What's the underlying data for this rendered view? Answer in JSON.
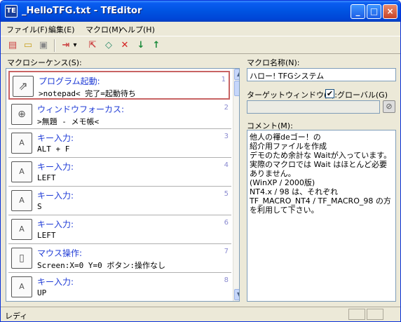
{
  "window": {
    "title": "_HelloTFG.txt - TfEditor",
    "icon_text": "TE"
  },
  "title_buttons": {
    "minimize": "_",
    "maximize": "□",
    "close": "×"
  },
  "menu": [
    "ファイル(F)",
    "編集(E)",
    "マクロ(M)",
    "ヘルプ(H)"
  ],
  "toolbar": {
    "icons": [
      "new-file-icon",
      "open-folder-icon",
      "save-icon",
      "insert-icon",
      "dropdown-arrow-icon",
      "export-icon",
      "eraser-icon",
      "delete-icon",
      "move-down-icon",
      "move-up-icon"
    ],
    "glyphs": {
      "new": "▤",
      "open": "▭",
      "save": "▣",
      "insert": "⇥",
      "dropdown": "▾",
      "export": "⇱",
      "eraser": "◇",
      "delete": "✕",
      "down": "↓",
      "up": "↑"
    },
    "colors": {
      "delete": "#d42020",
      "arrows": "#1a8a3a"
    }
  },
  "sequence": {
    "label": "マクロシーケンス(S):",
    "items": [
      {
        "title": "プログラム起動:",
        "detail": ">notepad< 完了=起動待ち",
        "num": "1",
        "icon": "rocket-icon",
        "glyph": "⇗"
      },
      {
        "title": "ウィンドウフォーカス:",
        "detail": ">無題 - メモ帳<",
        "num": "2",
        "icon": "window-focus-icon",
        "glyph": "⊕"
      },
      {
        "title": "キー入力:",
        "detail": "ALT + F",
        "num": "3",
        "icon": "keyboard-icon",
        "glyph": "A"
      },
      {
        "title": "キー入力:",
        "detail": "LEFT",
        "num": "4",
        "icon": "keyboard-icon",
        "glyph": "A"
      },
      {
        "title": "キー入力:",
        "detail": "S",
        "num": "5",
        "icon": "keyboard-icon",
        "glyph": "A"
      },
      {
        "title": "キー入力:",
        "detail": "LEFT",
        "num": "6",
        "icon": "keyboard-icon",
        "glyph": "A"
      },
      {
        "title": "マウス操作:",
        "detail": "Screen:X=0 Y=0  ボタン:操作なし",
        "num": "7",
        "icon": "mouse-icon",
        "glyph": "▯"
      },
      {
        "title": "キー入力:",
        "detail": "UP",
        "num": "8",
        "icon": "keyboard-icon",
        "glyph": "A"
      }
    ]
  },
  "macro_name": {
    "label": "マクロ名称(N):",
    "value": "ハロー! TFGシステム"
  },
  "target_window": {
    "label": "ターゲットウィンドウ(T):",
    "value": "",
    "global_label": "グローバル(G)",
    "global_checked": true,
    "clear_glyph": "⊘"
  },
  "comment": {
    "label": "コメント(M):",
    "lines": [
      "他人の褌deゴー！の",
      "紹介用ファイルを作成",
      "デモのため余計な Waitが入っています。",
      "実際のマクロでは Wait はほとんど必要",
      "ありません。",
      "(WinXP / 2000版)",
      "NT4.x / 98 は、それぞれ",
      "TF_MACRO_NT4 / TF_MACRO_98 の方",
      "を利用して下さい。"
    ]
  },
  "status": {
    "text": "レディ"
  },
  "colors": {
    "title_blue": "#0053e1",
    "seq_title": "#1f3bd6",
    "selected_border": "#c86464"
  }
}
